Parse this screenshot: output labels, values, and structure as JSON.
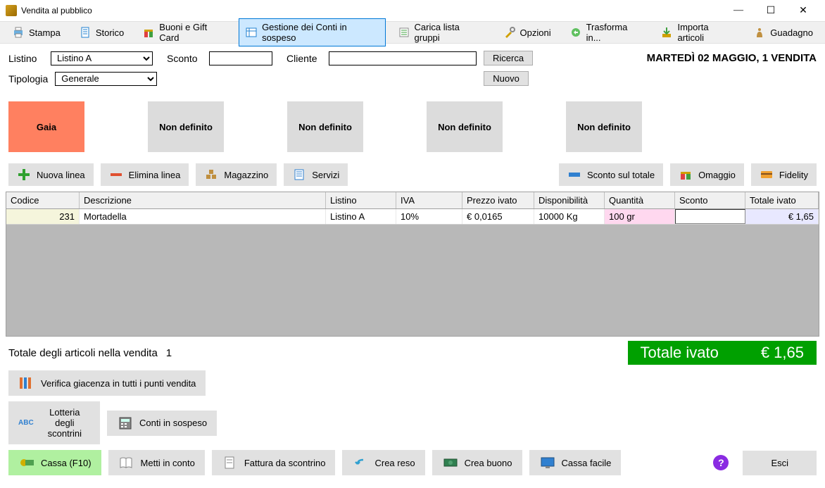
{
  "window": {
    "title": "Vendita al pubblico"
  },
  "toolbar": {
    "stampa": "Stampa",
    "storico": "Storico",
    "buoni": "Buoni e Gift Card",
    "conti": "Gestione dei Conti in sospeso",
    "gruppi": "Carica lista gruppi",
    "opzioni": "Opzioni",
    "trasforma": "Trasforma in...",
    "importa": "Importa articoli",
    "guadagno": "Guadagno"
  },
  "filters": {
    "listino_lbl": "Listino",
    "listino_val": "Listino A",
    "sconto_lbl": "Sconto",
    "sconto_val": "",
    "cliente_lbl": "Cliente",
    "cliente_val": "",
    "ricerca": "Ricerca",
    "tipologia_lbl": "Tipologia",
    "tipologia_val": "Generale",
    "nuovo": "Nuovo",
    "date": "MARTEDÌ 02 MAGGIO, 1 VENDITA"
  },
  "categories": [
    "Gaia",
    "Non definito",
    "Non definito",
    "Non definito",
    "Non definito"
  ],
  "actions": {
    "nuova_linea": "Nuova linea",
    "elimina_linea": "Elimina linea",
    "magazzino": "Magazzino",
    "servizi": "Servizi",
    "sconto_totale": "Sconto sul totale",
    "omaggio": "Omaggio",
    "fidelity": "Fidelity"
  },
  "table": {
    "headers": {
      "codice": "Codice",
      "descrizione": "Descrizione",
      "listino": "Listino",
      "iva": "IVA",
      "prezzo": "Prezzo ivato",
      "disp": "Disponibilità",
      "qty": "Quantità",
      "sconto": "Sconto",
      "totiv": "Totale ivato"
    },
    "rows": [
      {
        "codice": "231",
        "descrizione": "Mortadella",
        "listino": "Listino A",
        "iva": "10%",
        "prezzo": "€ 0,0165",
        "disp": "10000 Kg",
        "qty": "100 gr",
        "sconto": "",
        "totiv": "€ 1,65"
      }
    ]
  },
  "summary": {
    "label": "Totale degli articoli nella vendita",
    "count": "1",
    "tot_label": "Totale ivato",
    "tot_value": "€ 1,65"
  },
  "bottom": {
    "verifica": "Verifica giacenza in tutti i punti vendita",
    "lotteria": "Lotteria degli scontrini",
    "conti_sospeso": "Conti in sospeso",
    "cassa": "Cassa (F10)",
    "metti_conto": "Metti in conto",
    "fattura": "Fattura da scontrino",
    "crea_reso": "Crea reso",
    "crea_buono": "Crea buono",
    "cassa_facile": "Cassa facile",
    "esci": "Esci"
  }
}
